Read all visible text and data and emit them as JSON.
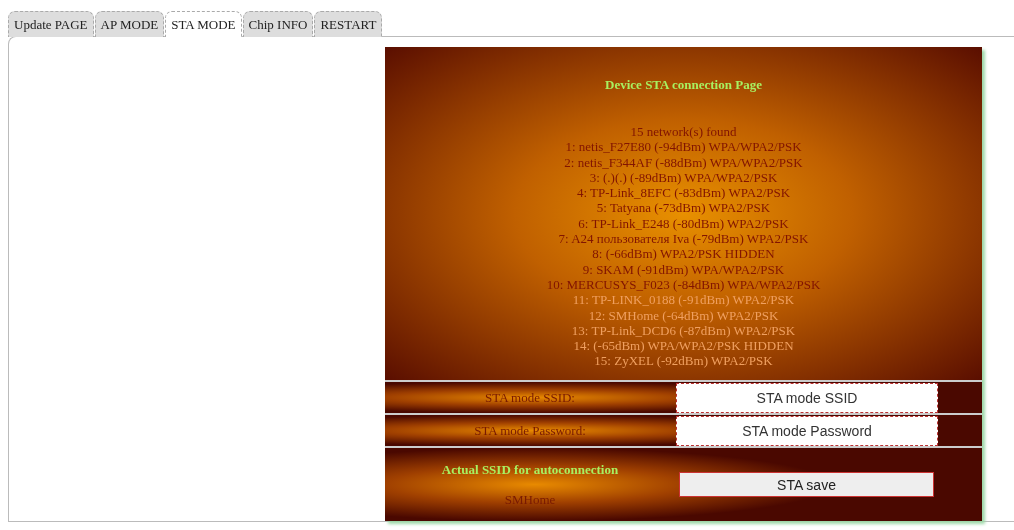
{
  "tabs": [
    {
      "label": "Update PAGE",
      "selected": false
    },
    {
      "label": "AP MODE",
      "selected": false
    },
    {
      "label": "STA MODE",
      "selected": true
    },
    {
      "label": "Chip INFO",
      "selected": false
    },
    {
      "label": "RESTART",
      "selected": false
    }
  ],
  "panel": {
    "title": "Device STA connection Page",
    "networks_count": "15 network(s) found",
    "networks": [
      "1: netis_F27E80 (-94dBm) WPA/WPA2/PSK",
      "2: netis_F344AF (-88dBm) WPA/WPA2/PSK",
      "3: (.)(.) (-89dBm) WPA/WPA2/PSK",
      "4: TP-Link_8EFC (-83dBm) WPA2/PSK",
      "5: Tatyana (-73dBm) WPA2/PSK",
      "6: TP-Link_E248 (-80dBm) WPA2/PSK",
      "7: A24 пользователя Iva (-79dBm) WPA2/PSK",
      "8: (-66dBm) WPA2/PSK HIDDEN",
      "9: SKAM (-91dBm) WPA/WPA2/PSK",
      "10: MERCUSYS_F023 (-84dBm) WPA/WPA2/PSK",
      "11: TP-LINK_0188 (-91dBm) WPA2/PSK",
      "12: SMHome (-64dBm) WPA2/PSK",
      "13: TP-Link_DCD6 (-87dBm) WPA2/PSK",
      "14: (-65dBm) WPA/WPA2/PSK HIDDEN",
      "15: ZyXEL (-92dBm) WPA2/PSK"
    ],
    "fields": [
      {
        "label": "STA mode SSID:",
        "placeholder": "STA mode SSID"
      },
      {
        "label": "STA mode Password:",
        "placeholder": "STA mode Password"
      }
    ],
    "actual_title": "Actual SSID for autoconnection",
    "actual_ssid": "SMHome",
    "save_button": "STA save"
  }
}
